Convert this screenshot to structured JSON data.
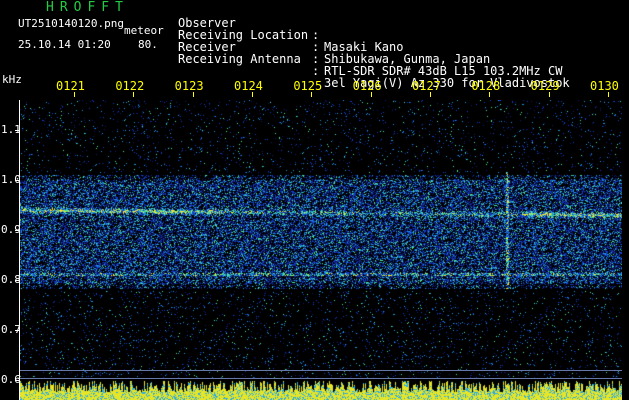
{
  "app": {
    "title": "HROFFT",
    "file_name": "UT2510140120.png",
    "mode": "meteor",
    "datetime": "25.10.14 01:20",
    "speed": "80."
  },
  "info": [
    {
      "label": "Observer",
      "value": "Masaki Kano"
    },
    {
      "label": "Receiving Location",
      "value": "Shibukawa, Gunma, Japan"
    },
    {
      "label": "Receiver",
      "value": "RTL-SDR SDR# 43dB L15 103.2MHz CW"
    },
    {
      "label": "Receiving Antenna",
      "value": "3el Yagi(V) Az 330 for Vladivostok"
    }
  ],
  "axis": {
    "unit": "kHz",
    "time_ticks": [
      "0121",
      "0122",
      "0123",
      "0124",
      "0125",
      "0126",
      "0127",
      "0128",
      "0129",
      "0130"
    ],
    "freq_ticks": [
      "1.1",
      "1.0",
      "0.9",
      "0.8",
      "0.7",
      "0.6"
    ]
  },
  "colors": {
    "background": "#000000",
    "title": "#22cc44",
    "text": "#ffffff",
    "ticks": "#ffff00",
    "noise_floor": "#101a6a",
    "signal": "#33ddcc",
    "hot": "#ffff33"
  }
}
